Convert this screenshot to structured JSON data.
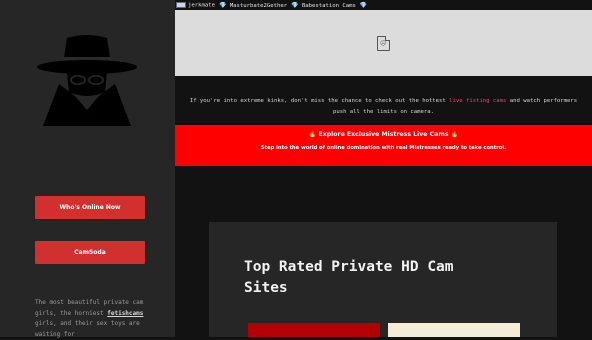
{
  "topbar": {
    "items": [
      {
        "label": "jerkmate",
        "icon": "flag-icon"
      },
      {
        "label": "Masturbate2Gether",
        "icon": "diamond-icon"
      },
      {
        "label": "Babestation Cams",
        "icon": "diamond-icon"
      }
    ],
    "trailing_icon": "diamond-icon"
  },
  "sidebar": {
    "logo": "spy-hat-logo",
    "buttons": [
      "Who's Online Now",
      "CamSoda"
    ],
    "text_before": "The most beautiful private cam girls, the horniest ",
    "text_link": "fetishcams",
    "text_after": " girls, and their sex toys are waiting for"
  },
  "banner": {
    "icon": "broken-image-icon"
  },
  "intro": {
    "before": "If you're into extreme kinks, don't miss the chance to check out the hottest ",
    "link": "live fisting cams",
    "after": " and watch performers push all the limits on camera."
  },
  "promo": {
    "title": "🔥 Explore Exclusive Mistress Live Cams 🔥",
    "subtitle": "Step into the world of online domination with real Mistresses ready to take control."
  },
  "card": {
    "heading": "Top Rated Private HD Cam Sites"
  },
  "colors": {
    "accent": "#d22f2f",
    "promo_bg": "#ff0000",
    "link": "#ff3b6b",
    "diamond": "#4fc3f7"
  }
}
